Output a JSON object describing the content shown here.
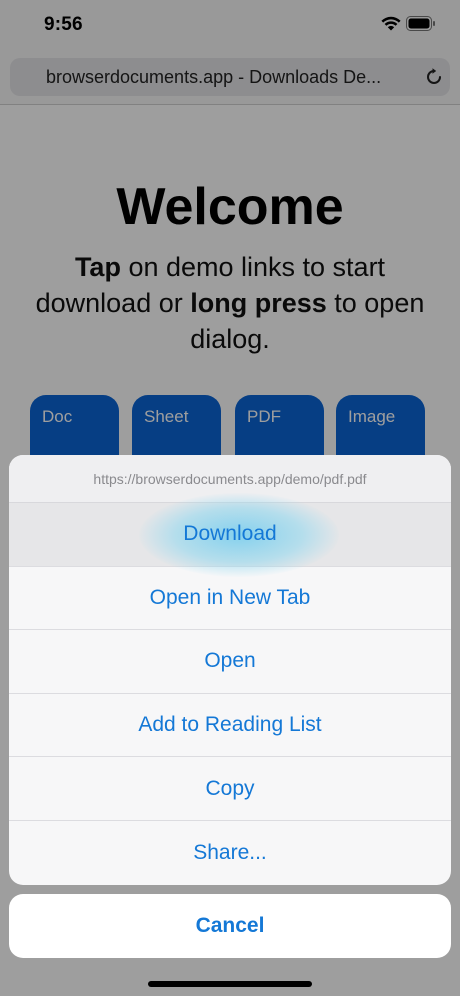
{
  "status_bar": {
    "time": "9:56"
  },
  "browser": {
    "url_text": "browserdocuments.app - Downloads De..."
  },
  "page": {
    "welcome_title": "Welcome",
    "intro_bold_1": "Tap",
    "intro_text_1": " on demo links to start download or ",
    "intro_bold_2": "long press",
    "intro_text_2": " to open dialog.",
    "demo_buttons": [
      "Doc",
      "Sheet",
      "PDF",
      "Image"
    ],
    "accent": "#0a64d6"
  },
  "action_sheet": {
    "link_url": "https://browserdocuments.app/demo/pdf.pdf",
    "items": [
      "Download",
      "Open in New Tab",
      "Open",
      "Add to Reading List",
      "Copy",
      "Share..."
    ],
    "cancel_label": "Cancel",
    "item_color": "#1478d6"
  },
  "icons": [
    "wifi-icon",
    "battery-icon",
    "reload-icon"
  ]
}
